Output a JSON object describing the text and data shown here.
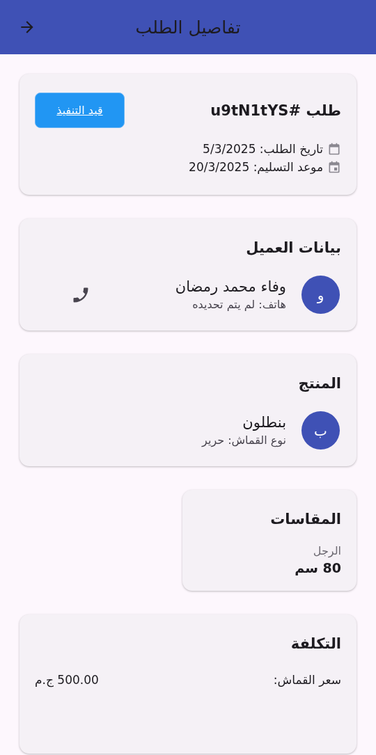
{
  "app_bar": {
    "title": "تفاصيل الطلب"
  },
  "order": {
    "title": "طلب #u9tN1tYS",
    "status": "قيد التنفيذ",
    "dates": [
      {
        "kind": "order",
        "text": "تاريخ الطلب: 5/3/2025"
      },
      {
        "kind": "delivery",
        "text": "موعد التسليم: 20/3/2025"
      }
    ]
  },
  "customer": {
    "heading": "بيانات العميل",
    "initial": "و",
    "name": "وفاء محمد رمضان",
    "phone": "هاتف: لم يتم تحديده"
  },
  "product": {
    "heading": "المنتج",
    "initial": "ب",
    "name": "بنطلون",
    "fabric": "نوع القماش: حرير"
  },
  "measurements": {
    "heading": "المقاسات",
    "items": [
      {
        "label": "الرجل",
        "value": "80 سم"
      }
    ]
  },
  "cost": {
    "heading": "التكلفة",
    "rows": [
      {
        "label": "سعر القماش:",
        "value": "500.00 ج.م"
      }
    ]
  }
}
